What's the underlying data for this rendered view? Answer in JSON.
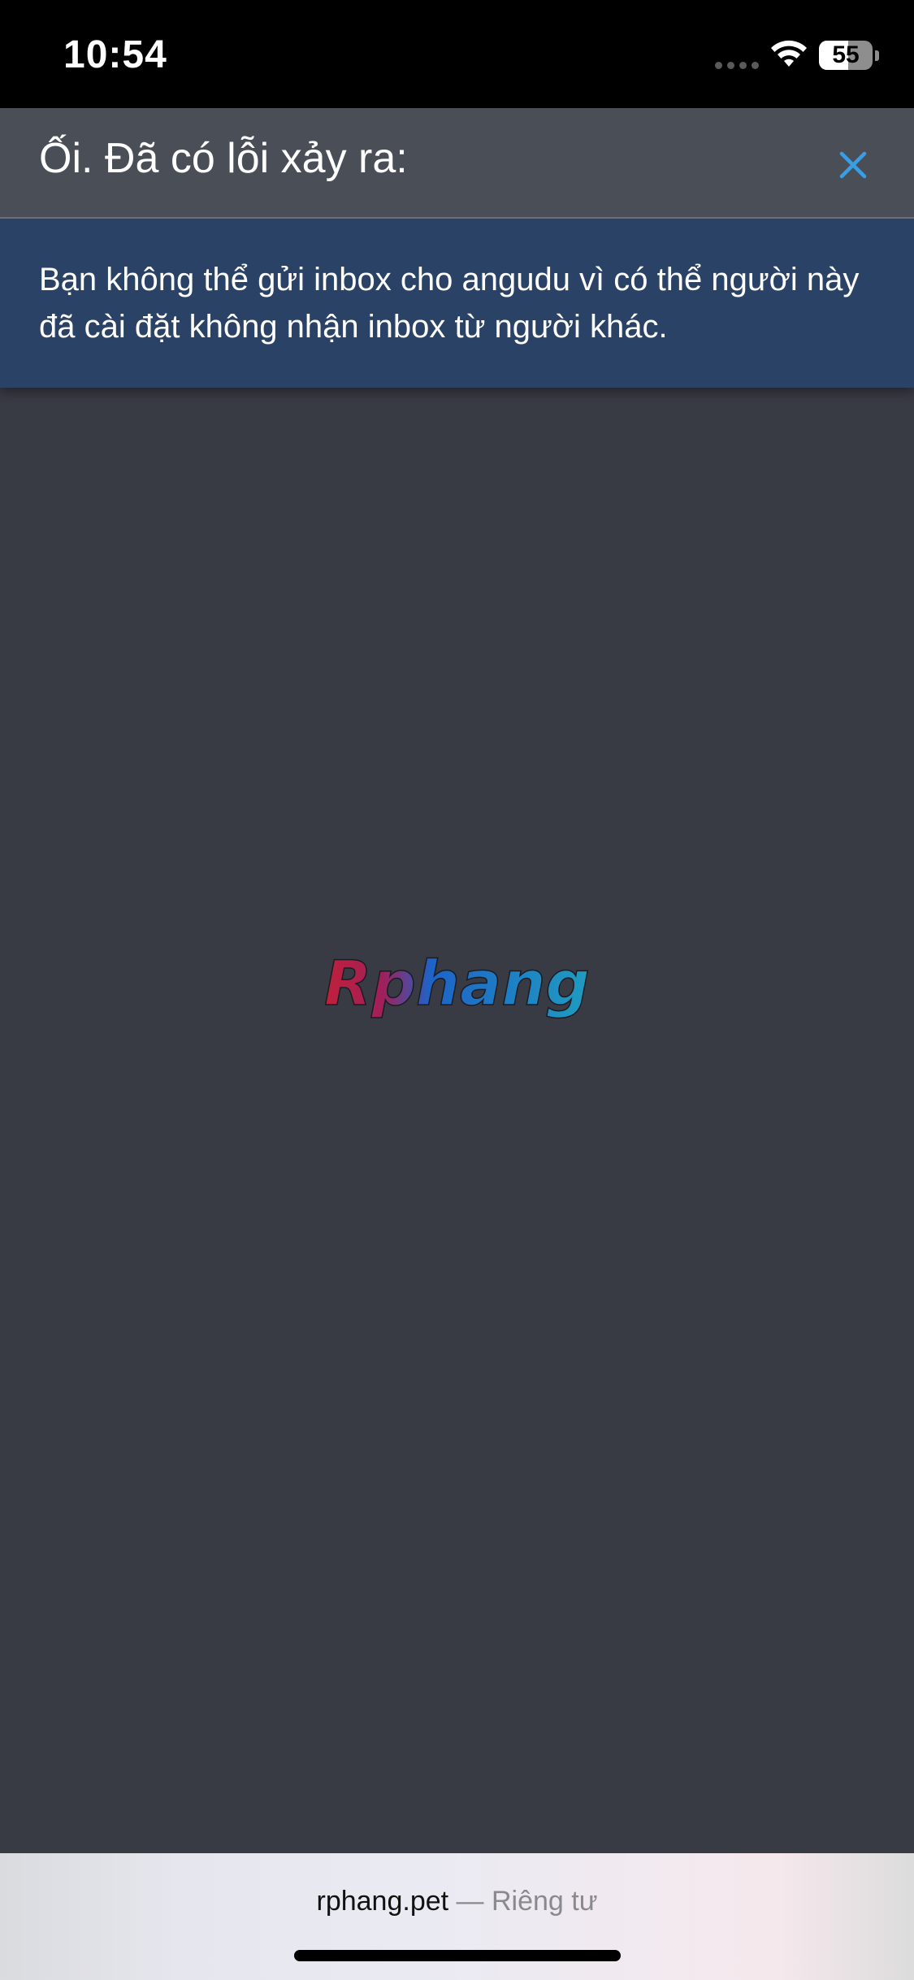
{
  "status_bar": {
    "time": "10:54",
    "battery_level": "55",
    "battery_fraction": 0.55
  },
  "dialog": {
    "title": "Ối. Đã có lỗi xảy ra:",
    "message": "Bạn không thể gửi inbox cho angudu vì có thể người này đã cài đặt không nhận inbox từ người khác.",
    "close_icon": "close-icon",
    "accent_color": "#3a9ee4",
    "header_color": "#4a4e57",
    "body_color": "#2a4266"
  },
  "logo": {
    "text": "Rphang",
    "colors": [
      "#c0203a",
      "#1e63c8",
      "#1f9cc0"
    ]
  },
  "browser_bar": {
    "domain": "rphang.pet",
    "separator": "—",
    "label": "Riêng tư"
  },
  "background_color": "#383a44"
}
